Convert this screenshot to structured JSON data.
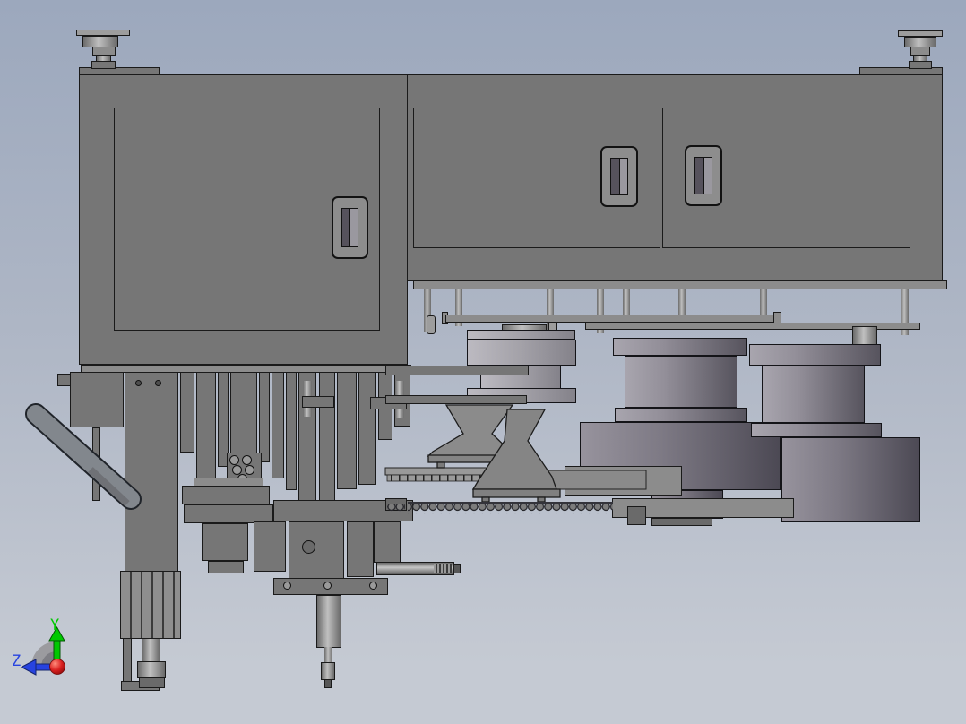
{
  "viewport": {
    "type": "cad-3d-view",
    "content": "industrial automation machine assembly, side view",
    "assemblies": [
      "leveling-foot",
      "electrical-cabinet",
      "cabinet-door",
      "door-handle",
      "support-column",
      "diagonal-chute",
      "tooling-mechanism",
      "pneumatic-cylinder",
      "vibratory-bowl-feeder",
      "conveyor-chain",
      "linear-rail"
    ]
  },
  "colors": {
    "bg-top": "#9ca8bd",
    "bg-mid": "#aeb6c5",
    "bg-bottom": "#c5cad3",
    "steel": "#767676",
    "steel-light": "#8d8d8d",
    "steel-dark": "#5e5e5e",
    "line": "#1a1a1a",
    "axis-y": "#00c800",
    "axis-z": "#2743e0",
    "origin": "#c41414"
  },
  "orientation_triad": {
    "y_label": "Y",
    "z_label": "Z"
  }
}
